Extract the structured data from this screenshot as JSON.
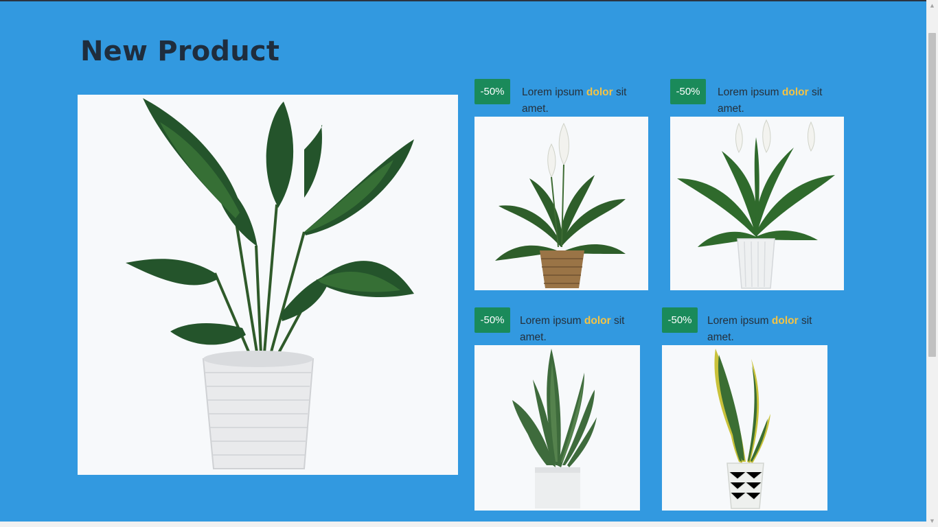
{
  "section": {
    "title": "New Product"
  },
  "hero": {
    "image_icon": "bird-of-paradise-plant-icon"
  },
  "products": [
    {
      "badge": "-50%",
      "text_start": "Lorem ipsum ",
      "text_highlight": "dolor",
      "text_end": " sit amet.",
      "image_icon": "peace-lily-basket-icon"
    },
    {
      "badge": "-50%",
      "text_start": "Lorem ipsum ",
      "text_highlight": "dolor",
      "text_end": " sit amet.",
      "image_icon": "peace-lily-white-pot-icon"
    },
    {
      "badge": "-50%",
      "text_start": "Lorem ipsum ",
      "text_highlight": "dolor",
      "text_end": " sit amet.",
      "image_icon": "snake-plant-icon"
    },
    {
      "badge": "-50%",
      "text_start": "Lorem ipsum ",
      "text_highlight": "dolor",
      "text_end": " sit amet.",
      "image_icon": "snake-plant-variegated-icon"
    }
  ],
  "colors": {
    "background": "#3299e0",
    "badge": "#1a8a5a",
    "highlight": "#f5c343",
    "title": "#1f2d3d"
  }
}
